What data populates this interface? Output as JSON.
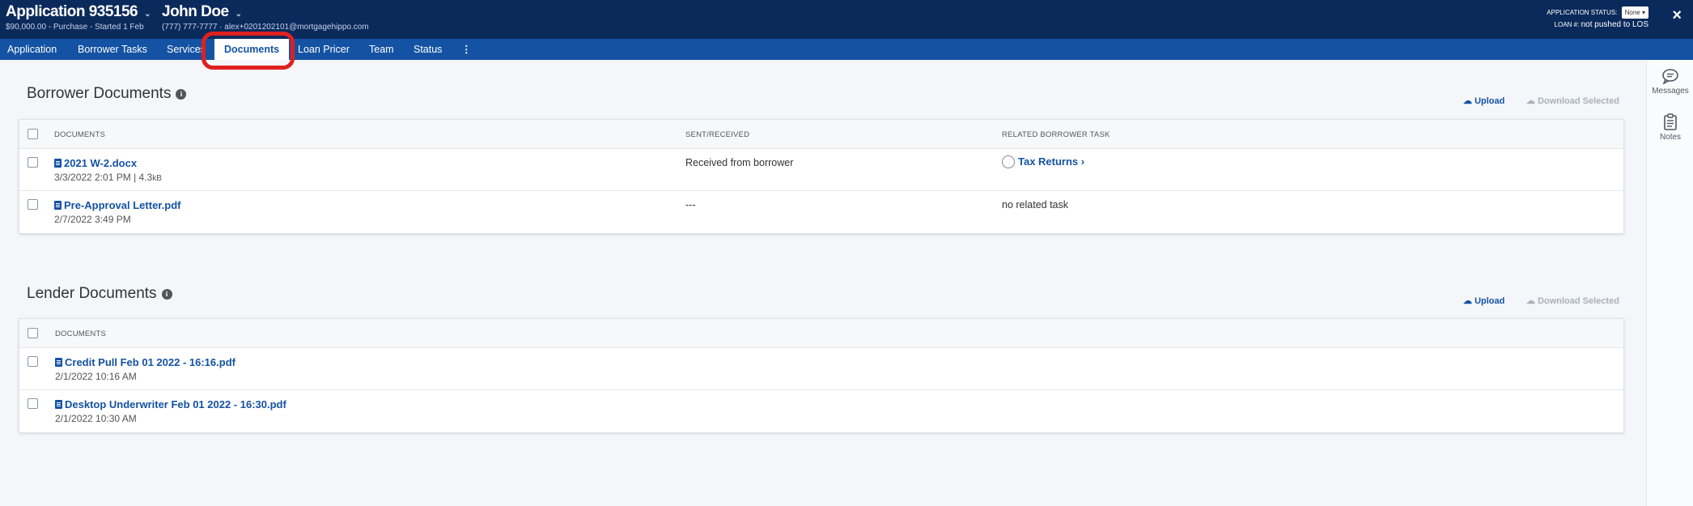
{
  "header": {
    "app_title": "Application 935156",
    "app_subtitle": "$90,000.00 - Purchase - Started 1 Feb",
    "borrower_name": "John Doe",
    "borrower_contact": "(777) 777-7777 · alex+0201202101@mortgagehippo.com",
    "status_label": "APPLICATION STATUS:",
    "status_value": "None",
    "loan_label": "LOAN #:",
    "loan_value": "not pushed to LOS",
    "close_label": "×"
  },
  "nav": {
    "application": "Application",
    "borrower_tasks": "Borrower Tasks",
    "services": "Services",
    "documents": "Documents",
    "loan_pricer": "Loan Pricer",
    "team": "Team",
    "status": "Status",
    "more": "⋮"
  },
  "rail": {
    "messages": "Messages",
    "notes": "Notes"
  },
  "borrower_docs": {
    "title": "Borrower Documents",
    "info": "i",
    "upload": "Upload",
    "download": "Download Selected",
    "col_documents": "DOCUMENTS",
    "col_sent": "SENT/RECEIVED",
    "col_task": "RELATED BORROWER TASK",
    "rows": [
      {
        "name": "2021 W-2.docx",
        "date": "3/3/2022 2:01 PM | 4.3",
        "size_unit": "kB",
        "sent": "Received from borrower",
        "task": "Tax Returns ›"
      },
      {
        "name": "Pre-Approval Letter.pdf",
        "date": "2/7/2022 3:49 PM",
        "sent": "---",
        "task": "no related task"
      }
    ]
  },
  "lender_docs": {
    "title": "Lender Documents",
    "info": "i",
    "upload": "Upload",
    "download": "Download Selected",
    "col_documents": "DOCUMENTS",
    "rows": [
      {
        "name": "Credit Pull Feb 01 2022 - 16:16.pdf",
        "date": "2/1/2022 10:16 AM"
      },
      {
        "name": "Desktop Underwriter Feb 01 2022 - 16:30.pdf",
        "date": "2/1/2022 10:30 AM"
      }
    ]
  },
  "colors": {
    "header_bg": "#0b2a5c",
    "nav_bg": "#1452a3",
    "link": "#1452a3",
    "highlight": "#e02020"
  }
}
